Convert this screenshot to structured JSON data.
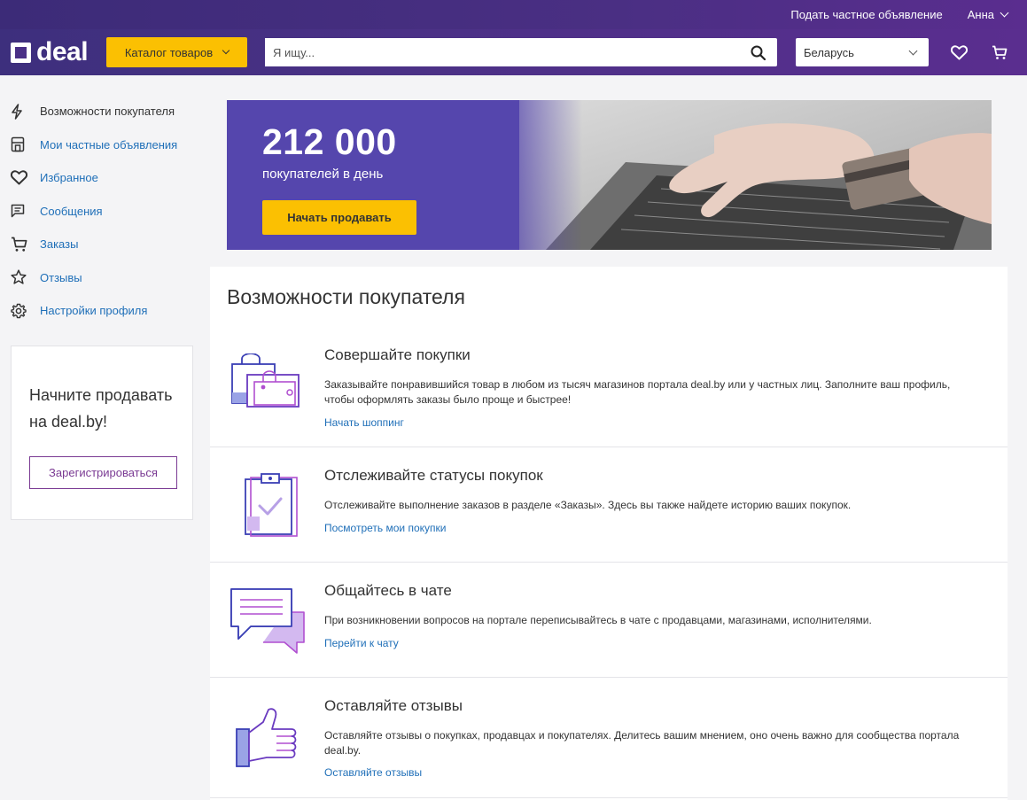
{
  "topbar": {
    "post_ad": "Подать частное объявление",
    "user_name": "Анна"
  },
  "header": {
    "logo_text": "deal",
    "catalog_label": "Каталог товаров",
    "search_placeholder": "Я ищу...",
    "region_value": "Беларусь",
    "icons": [
      "heart-icon",
      "cart-icon"
    ]
  },
  "sidebar": {
    "items": [
      {
        "label": "Возможности покупателя",
        "icon": "lightning-icon",
        "active": true
      },
      {
        "label": "Мои частные объявления",
        "icon": "storefront-icon"
      },
      {
        "label": "Избранное",
        "icon": "heart-icon"
      },
      {
        "label": "Сообщения",
        "icon": "message-icon"
      },
      {
        "label": "Заказы",
        "icon": "cart-icon"
      },
      {
        "label": "Отзывы",
        "icon": "star-icon"
      },
      {
        "label": "Настройки профиля",
        "icon": "gear-icon"
      }
    ],
    "sell_card": {
      "title_line1": "Начните продавать",
      "title_line2": "на deal.by!",
      "button": "Зарегистрироваться"
    }
  },
  "banner": {
    "number": "212 000",
    "subtitle": "покупателей в день",
    "cta": "Начать продавать"
  },
  "main": {
    "title": "Возможности покупателя",
    "features": [
      {
        "title": "Совершайте покупки",
        "desc": "Заказывайте понравившийся товар в любом из тысяч магазинов портала deal.by или у частных лиц. Заполните ваш профиль, чтобы оформлять заказы было проще и быстрее!",
        "link": "Начать шоппинг",
        "icon": "shopping-bags-icon"
      },
      {
        "title": "Отслеживайте статусы покупок",
        "desc": "Отслеживайте выполнение заказов в разделе «Заказы». Здесь вы также найдете историю ваших покупок.",
        "link": "Посмотреть мои покупки",
        "icon": "clipboard-check-icon"
      },
      {
        "title": "Общайтесь в чате",
        "desc": "При возникновении вопросов на портале переписывайтесь в чате с продавцами, магазинами, исполнителями.",
        "link": "Перейти к чату",
        "icon": "chat-bubbles-icon"
      },
      {
        "title": "Оставляйте отзывы",
        "desc": "Оставляйте отзывы о покупках, продавцах и покупателях. Делитесь вашим мнением, оно очень важно для сообщества портала deal.by.",
        "link": "Оставляйте отзывы",
        "icon": "thumbs-up-icon"
      }
    ]
  },
  "colors": {
    "header_purple": "#4b3186",
    "accent_yellow": "#fbc002",
    "link_blue": "#1f6fb8",
    "register_purple": "#7a3a93"
  }
}
